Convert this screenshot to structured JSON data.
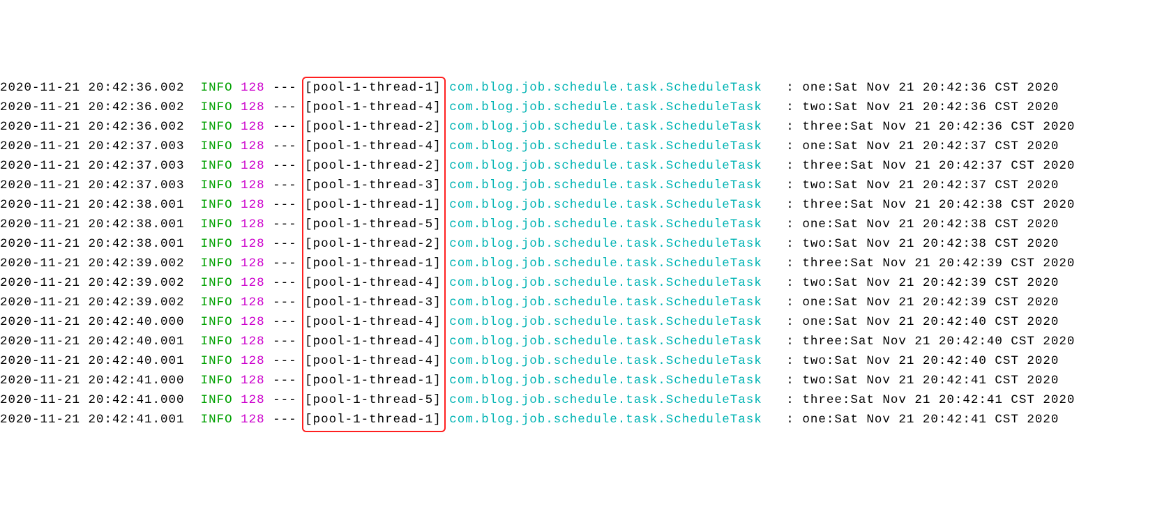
{
  "logs": [
    {
      "ts": "2020-11-21 20:42:36.002",
      "level": "INFO",
      "pid": "128",
      "dash": "---",
      "thread": "[pool-1-thread-1]",
      "logger": "com.blog.job.schedule.task.ScheduleTask",
      "sep": ":",
      "msg": "one:Sat Nov 21 20:42:36 CST 2020"
    },
    {
      "ts": "2020-11-21 20:42:36.002",
      "level": "INFO",
      "pid": "128",
      "dash": "---",
      "thread": "[pool-1-thread-4]",
      "logger": "com.blog.job.schedule.task.ScheduleTask",
      "sep": ":",
      "msg": "two:Sat Nov 21 20:42:36 CST 2020"
    },
    {
      "ts": "2020-11-21 20:42:36.002",
      "level": "INFO",
      "pid": "128",
      "dash": "---",
      "thread": "[pool-1-thread-2]",
      "logger": "com.blog.job.schedule.task.ScheduleTask",
      "sep": ":",
      "msg": "three:Sat Nov 21 20:42:36 CST 2020"
    },
    {
      "ts": "2020-11-21 20:42:37.003",
      "level": "INFO",
      "pid": "128",
      "dash": "---",
      "thread": "[pool-1-thread-4]",
      "logger": "com.blog.job.schedule.task.ScheduleTask",
      "sep": ":",
      "msg": "one:Sat Nov 21 20:42:37 CST 2020"
    },
    {
      "ts": "2020-11-21 20:42:37.003",
      "level": "INFO",
      "pid": "128",
      "dash": "---",
      "thread": "[pool-1-thread-2]",
      "logger": "com.blog.job.schedule.task.ScheduleTask",
      "sep": ":",
      "msg": "three:Sat Nov 21 20:42:37 CST 2020"
    },
    {
      "ts": "2020-11-21 20:42:37.003",
      "level": "INFO",
      "pid": "128",
      "dash": "---",
      "thread": "[pool-1-thread-3]",
      "logger": "com.blog.job.schedule.task.ScheduleTask",
      "sep": ":",
      "msg": "two:Sat Nov 21 20:42:37 CST 2020"
    },
    {
      "ts": "2020-11-21 20:42:38.001",
      "level": "INFO",
      "pid": "128",
      "dash": "---",
      "thread": "[pool-1-thread-1]",
      "logger": "com.blog.job.schedule.task.ScheduleTask",
      "sep": ":",
      "msg": "three:Sat Nov 21 20:42:38 CST 2020"
    },
    {
      "ts": "2020-11-21 20:42:38.001",
      "level": "INFO",
      "pid": "128",
      "dash": "---",
      "thread": "[pool-1-thread-5]",
      "logger": "com.blog.job.schedule.task.ScheduleTask",
      "sep": ":",
      "msg": "one:Sat Nov 21 20:42:38 CST 2020"
    },
    {
      "ts": "2020-11-21 20:42:38.001",
      "level": "INFO",
      "pid": "128",
      "dash": "---",
      "thread": "[pool-1-thread-2]",
      "logger": "com.blog.job.schedule.task.ScheduleTask",
      "sep": ":",
      "msg": "two:Sat Nov 21 20:42:38 CST 2020"
    },
    {
      "ts": "2020-11-21 20:42:39.002",
      "level": "INFO",
      "pid": "128",
      "dash": "---",
      "thread": "[pool-1-thread-1]",
      "logger": "com.blog.job.schedule.task.ScheduleTask",
      "sep": ":",
      "msg": "three:Sat Nov 21 20:42:39 CST 2020"
    },
    {
      "ts": "2020-11-21 20:42:39.002",
      "level": "INFO",
      "pid": "128",
      "dash": "---",
      "thread": "[pool-1-thread-4]",
      "logger": "com.blog.job.schedule.task.ScheduleTask",
      "sep": ":",
      "msg": "two:Sat Nov 21 20:42:39 CST 2020"
    },
    {
      "ts": "2020-11-21 20:42:39.002",
      "level": "INFO",
      "pid": "128",
      "dash": "---",
      "thread": "[pool-1-thread-3]",
      "logger": "com.blog.job.schedule.task.ScheduleTask",
      "sep": ":",
      "msg": "one:Sat Nov 21 20:42:39 CST 2020"
    },
    {
      "ts": "2020-11-21 20:42:40.000",
      "level": "INFO",
      "pid": "128",
      "dash": "---",
      "thread": "[pool-1-thread-4]",
      "logger": "com.blog.job.schedule.task.ScheduleTask",
      "sep": ":",
      "msg": "one:Sat Nov 21 20:42:40 CST 2020"
    },
    {
      "ts": "2020-11-21 20:42:40.001",
      "level": "INFO",
      "pid": "128",
      "dash": "---",
      "thread": "[pool-1-thread-4]",
      "logger": "com.blog.job.schedule.task.ScheduleTask",
      "sep": ":",
      "msg": "three:Sat Nov 21 20:42:40 CST 2020"
    },
    {
      "ts": "2020-11-21 20:42:40.001",
      "level": "INFO",
      "pid": "128",
      "dash": "---",
      "thread": "[pool-1-thread-4]",
      "logger": "com.blog.job.schedule.task.ScheduleTask",
      "sep": ":",
      "msg": "two:Sat Nov 21 20:42:40 CST 2020"
    },
    {
      "ts": "2020-11-21 20:42:41.000",
      "level": "INFO",
      "pid": "128",
      "dash": "---",
      "thread": "[pool-1-thread-1]",
      "logger": "com.blog.job.schedule.task.ScheduleTask",
      "sep": ":",
      "msg": "two:Sat Nov 21 20:42:41 CST 2020"
    },
    {
      "ts": "2020-11-21 20:42:41.000",
      "level": "INFO",
      "pid": "128",
      "dash": "---",
      "thread": "[pool-1-thread-5]",
      "logger": "com.blog.job.schedule.task.ScheduleTask",
      "sep": ":",
      "msg": "three:Sat Nov 21 20:42:41 CST 2020"
    },
    {
      "ts": "2020-11-21 20:42:41.001",
      "level": "INFO",
      "pid": "128",
      "dash": "---",
      "thread": "[pool-1-thread-1]",
      "logger": "com.blog.job.schedule.task.ScheduleTask",
      "sep": ":",
      "msg": "one:Sat Nov 21 20:42:41 CST 2020"
    }
  ],
  "highlight": {
    "box": true
  }
}
